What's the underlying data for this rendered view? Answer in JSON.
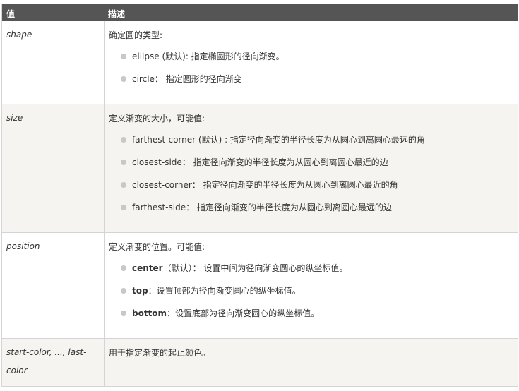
{
  "header": {
    "col1": "值",
    "col2": "描述"
  },
  "rows": [
    {
      "value": "shape",
      "desc": "确定圆的类型:",
      "items": [
        {
          "kw": "ellipse",
          "text": " (默认): 指定椭圆形的径向渐变。"
        },
        {
          "kw": "circle",
          "text": "： 指定圆形的径向渐变"
        }
      ]
    },
    {
      "value": "size",
      "desc": "定义渐变的大小，可能值:",
      "items": [
        {
          "kw": "farthest-corner",
          "text": " (默认) : 指定径向渐变的半径长度为从圆心到离圆心最远的角"
        },
        {
          "kw": "closest-side",
          "text": "： 指定径向渐变的半径长度为从圆心到离圆心最近的边"
        },
        {
          "kw": "closest-corner",
          "text": "：  指定径向渐变的半径长度为从圆心到离圆心最近的角"
        },
        {
          "kw": "farthest-side",
          "text": "： 指定径向渐变的半径长度为从圆心到离圆心最远的边"
        }
      ]
    },
    {
      "value": "position",
      "desc": "定义渐变的位置。可能值:",
      "items": [
        {
          "kw": "center",
          "text": "（默认）： 设置中间为径向渐变圆心的纵坐标值。"
        },
        {
          "kw": "top",
          "text": "：设置顶部为径向渐变圆心的纵坐标值。"
        },
        {
          "kw": "bottom",
          "text": "：设置底部为径向渐变圆心的纵坐标值。"
        }
      ]
    },
    {
      "value_line1": "start-color, ..., last-",
      "value_line2": "color",
      "desc": "用于指定渐变的起止颜色。"
    }
  ]
}
